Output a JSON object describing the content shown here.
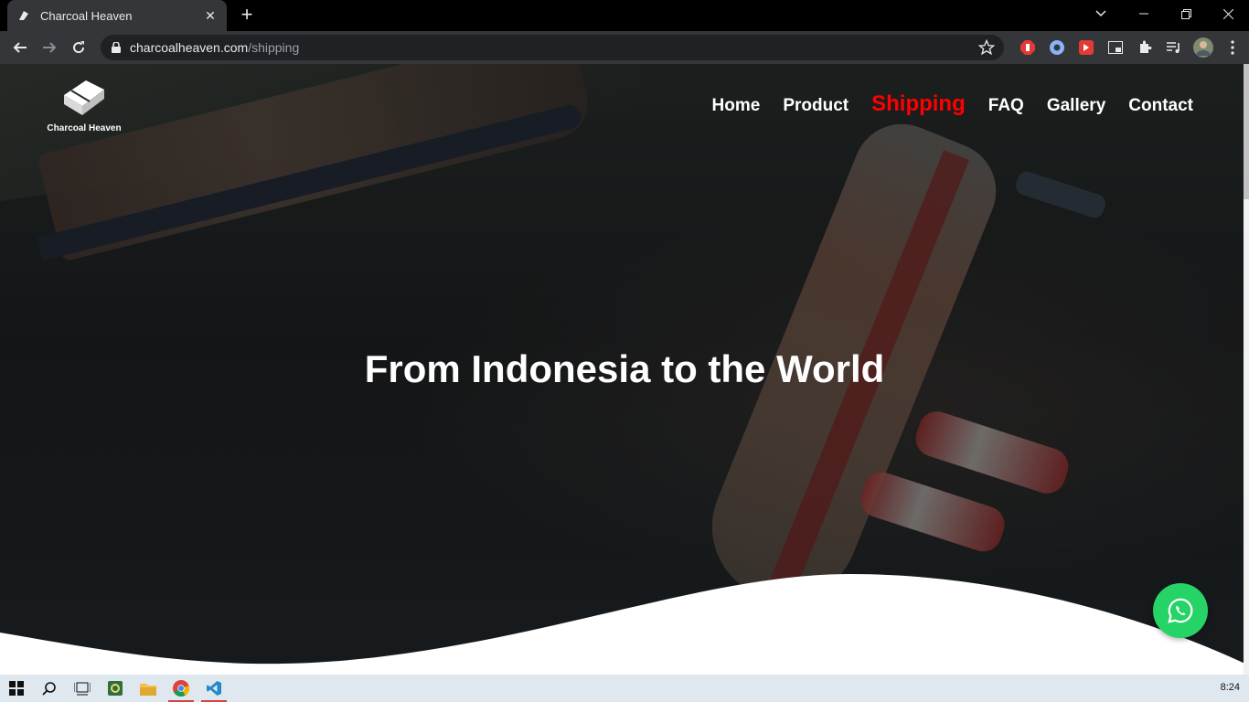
{
  "browser": {
    "tab_title": "Charcoal Heaven",
    "url_host": "charcoalheaven.com",
    "url_path": "/shipping",
    "icons": [
      "back-icon",
      "forward-icon",
      "reload-icon",
      "lock-icon",
      "star-icon",
      "extensions-icon",
      "menu-icon"
    ]
  },
  "site": {
    "logo_text": "Charcoal Heaven",
    "nav": [
      {
        "label": "Home"
      },
      {
        "label": "Product"
      },
      {
        "label": "Shipping"
      },
      {
        "label": "FAQ"
      },
      {
        "label": "Gallery"
      },
      {
        "label": "Contact"
      }
    ],
    "active_nav": "Shipping",
    "hero_title": "From Indonesia to the World",
    "whatsapp_icon": "whatsapp-icon"
  },
  "taskbar": {
    "clock": "8:24"
  },
  "colors": {
    "active_nav": "#ff0000",
    "whatsapp": "#25d366"
  }
}
